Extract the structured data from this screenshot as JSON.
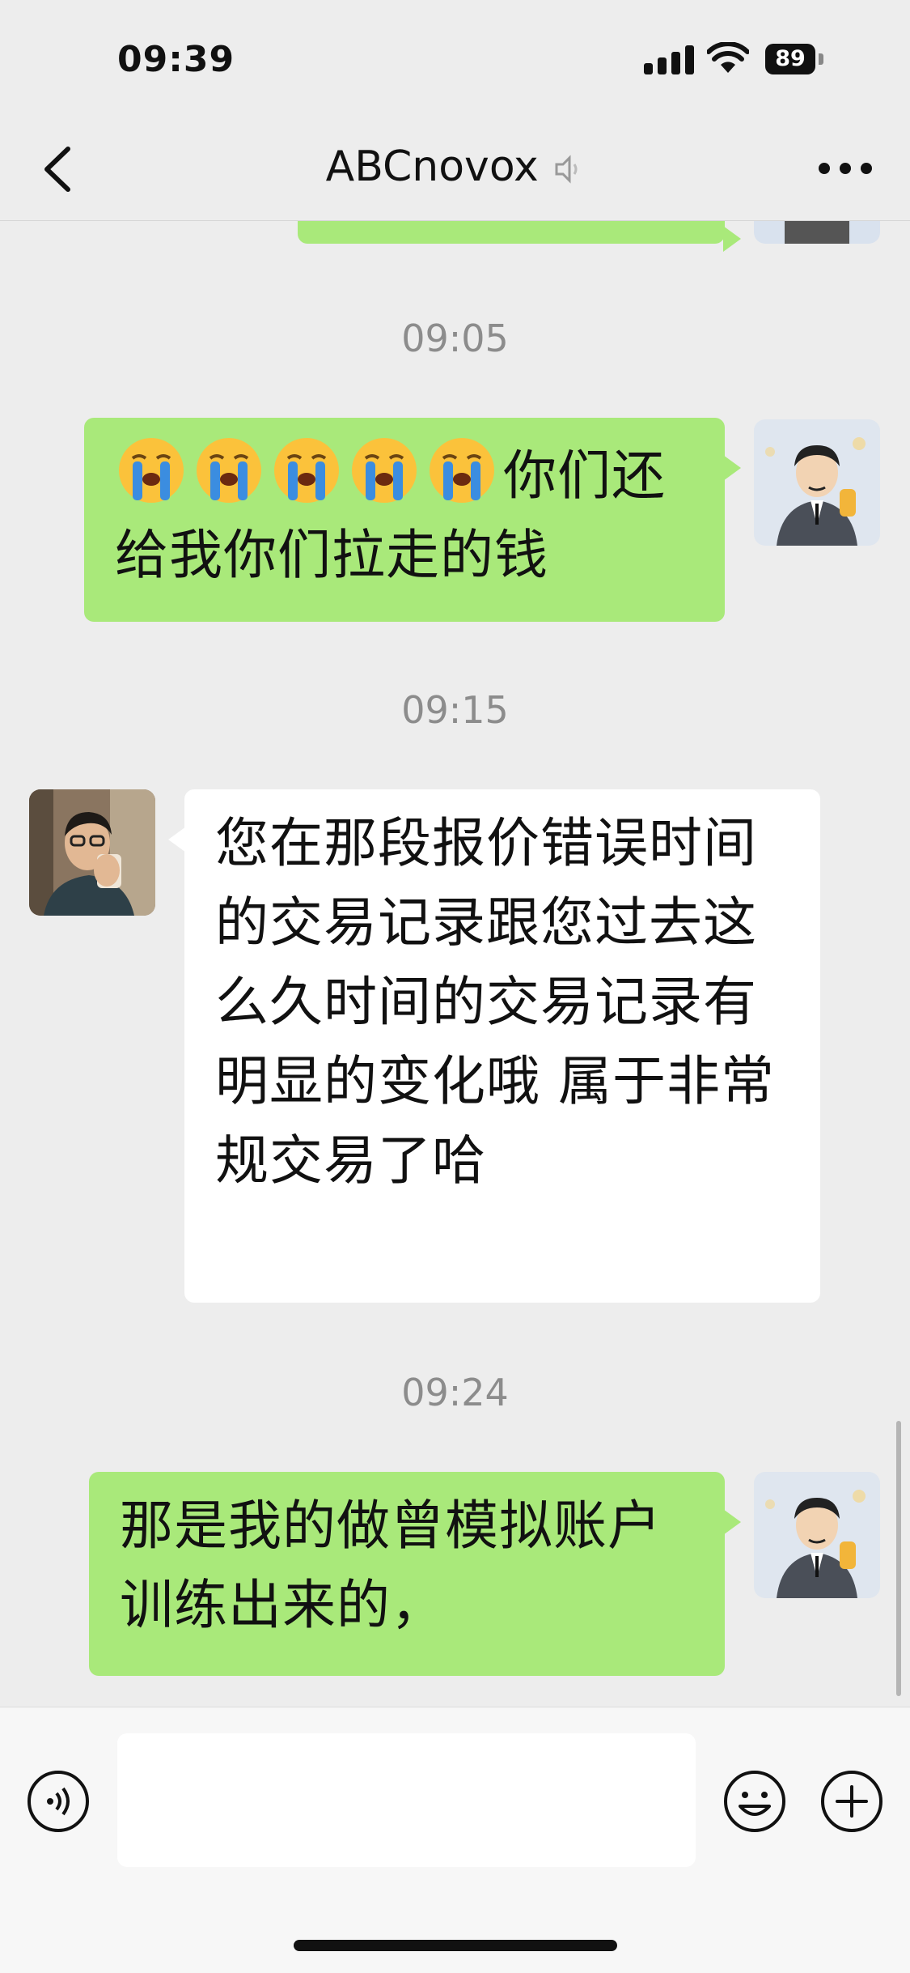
{
  "status_bar": {
    "time": "09:39",
    "battery": "89"
  },
  "nav": {
    "title": "ABCnovox"
  },
  "messages": [
    {
      "type": "timestamp",
      "text": "09:05"
    },
    {
      "type": "sent",
      "emoji_icons": [
        "crying-face-icon",
        "crying-face-icon",
        "crying-face-icon",
        "crying-face-icon",
        "crying-face-icon"
      ],
      "text": "你们还给我你们拉走的钱"
    },
    {
      "type": "timestamp",
      "text": "09:15"
    },
    {
      "type": "received",
      "text": "您在那段报价错误时间的交易记录跟您过去这么久时间的交易记录有明显的变化哦 属于非常规交易了哈"
    },
    {
      "type": "timestamp",
      "text": "09:24"
    },
    {
      "type": "sent",
      "text": "那是我的做曾模拟账户训练出来的，"
    }
  ],
  "input": {
    "value": "",
    "placeholder": ""
  },
  "colors": {
    "sent_bubble": "#a9e97a",
    "received_bubble": "#ffffff",
    "background": "#ededed"
  }
}
